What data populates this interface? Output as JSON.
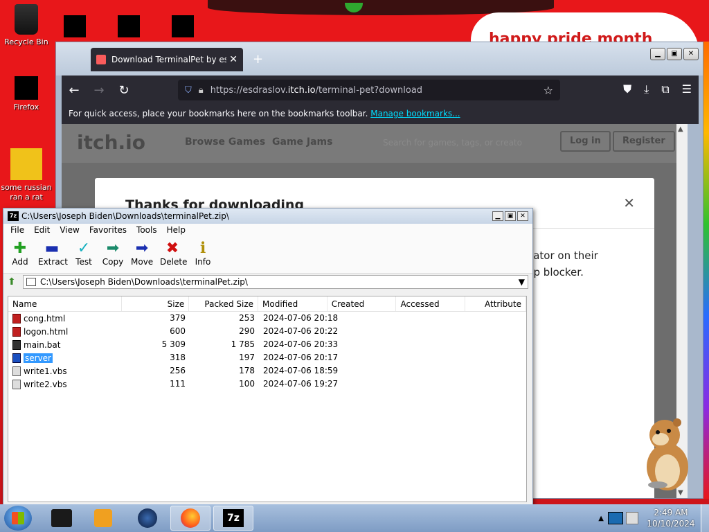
{
  "desktop": {
    "banner_text": "happy pride month",
    "icons": [
      {
        "label": "Recycle Bin"
      },
      {
        "label": "Firefox"
      },
      {
        "label": "some russian ran a rat"
      }
    ]
  },
  "firefox": {
    "tab_title": "Download TerminalPet by esdra",
    "url_prefix": "https://esdraslov.",
    "url_domain": "itch.io",
    "url_path": "/terminal-pet?download",
    "bookmarks_text": "For quick access, place your bookmarks here on the bookmarks toolbar.",
    "bookmarks_link": "Manage bookmarks...",
    "page": {
      "logo": "itch.io",
      "nav": [
        "Browse Games",
        "Game Jams"
      ],
      "search_placeholder": "Search for games, tags, or creato",
      "login": "Log in",
      "register": "Register",
      "dialog_title": "Thanks for downloading",
      "dialog_text_line1": "eator on their",
      "dialog_text_line2": "up blocker."
    }
  },
  "sevenzip": {
    "title": "C:\\Users\\Joseph Biden\\Downloads\\terminalPet.zip\\",
    "menu": [
      "File",
      "Edit",
      "View",
      "Favorites",
      "Tools",
      "Help"
    ],
    "toolbar": [
      {
        "label": "Add",
        "icon": "add-icon"
      },
      {
        "label": "Extract",
        "icon": "extract-icon"
      },
      {
        "label": "Test",
        "icon": "test-icon"
      },
      {
        "label": "Copy",
        "icon": "copy-icon"
      },
      {
        "label": "Move",
        "icon": "move-icon"
      },
      {
        "label": "Delete",
        "icon": "delete-icon"
      },
      {
        "label": "Info",
        "icon": "info-icon"
      }
    ],
    "address": "C:\\Users\\Joseph Biden\\Downloads\\terminalPet.zip\\",
    "columns": [
      "Name",
      "Size",
      "Packed Size",
      "Modified",
      "Created",
      "Accessed",
      "Attribute"
    ],
    "files": [
      {
        "name": "cong.html",
        "size": "379",
        "packed": "253",
        "modified": "2024-07-06 20:18",
        "type": "html"
      },
      {
        "name": "logon.html",
        "size": "600",
        "packed": "290",
        "modified": "2024-07-06 20:22",
        "type": "html"
      },
      {
        "name": "main.bat",
        "size": "5 309",
        "packed": "1 785",
        "modified": "2024-07-06 20:33",
        "type": "bat"
      },
      {
        "name": "server",
        "size": "318",
        "packed": "197",
        "modified": "2024-07-06 20:17",
        "type": "blue",
        "selected": true
      },
      {
        "name": "write1.vbs",
        "size": "256",
        "packed": "178",
        "modified": "2024-07-06 18:59",
        "type": "vbs"
      },
      {
        "name": "write2.vbs",
        "size": "111",
        "packed": "100",
        "modified": "2024-07-06 19:27",
        "type": "vbs"
      }
    ]
  },
  "taskbar": {
    "time": "2:49 AM",
    "date": "10/10/2024",
    "active_item": "7z"
  }
}
